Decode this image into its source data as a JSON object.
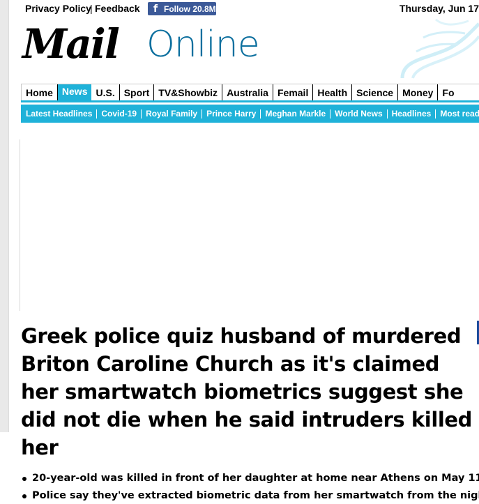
{
  "topbar": {
    "privacy_policy": "Privacy Policy",
    "separator": "|",
    "feedback": "Feedback",
    "facebook_icon": "f",
    "facebook_follow": "Follow 20.8M",
    "date": "Thursday, Jun 17"
  },
  "logo": {
    "mail": "Mail",
    "online": "Online",
    "online_color": "#0c6f9e"
  },
  "nav": {
    "items": [
      "Home",
      "News",
      "U.S.",
      "Sport",
      "TV&Showbiz",
      "Australia",
      "Femail",
      "Health",
      "Science",
      "Money",
      "Fo"
    ],
    "active": "News",
    "accent_color": "#1fb2d9"
  },
  "subnav": {
    "items": [
      "Latest Headlines",
      "Covid-19",
      "Royal Family",
      "Prince Harry",
      "Meghan Markle",
      "World News",
      "Headlines",
      "Most read"
    ]
  },
  "article": {
    "headline": "Greek police quiz husband of murdered Briton Caroline Church as it's claimed her smartwatch biometrics suggest she did not die when he said intruders killed her",
    "bullets": [
      "20-year-old was killed in front of her daughter at home near Athens on May 11",
      "Police say they've extracted biometric data from her smartwatch from the night"
    ]
  }
}
